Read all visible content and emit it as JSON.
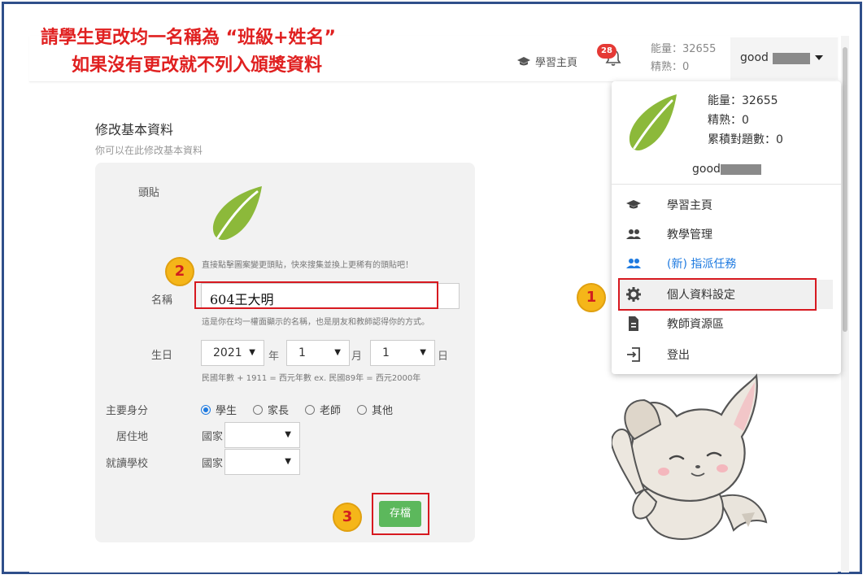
{
  "annotation": {
    "line1": "請學生更改均一名稱為 “班級+姓名”",
    "line2": "如果沒有更改就不列入頒獎資料",
    "steps": [
      "1",
      "2",
      "3"
    ]
  },
  "header": {
    "home_link": "學習主頁",
    "notifications": "28",
    "energy": "能量：32655",
    "badges": "精熟：0",
    "username": "good"
  },
  "main": {
    "title": "修改基本資料",
    "subtitle": "你可以在此修改基本資料",
    "avatar_label": "頭貼",
    "avatar_hint": "直接點擊圖案變更頭貼，快來搜集並換上更稀有的頭貼吧！",
    "name_label": "名稱",
    "name_value": "604王大明",
    "name_hint": "這是你在均一權面顯示的名稱，也是朋友和教師認得你的方式。",
    "birthday_label": "生日",
    "year_value": "2021",
    "year_unit": "年",
    "month_value": "1",
    "month_unit": "月",
    "day_value": "1",
    "day_unit": "日",
    "birthday_hint": "民國年數 + 1911 = 西元年數 ex. 民國89年 = 西元2000年",
    "identity_label": "主要身分",
    "identity_options": [
      "學生",
      "家長",
      "老師",
      "其他"
    ],
    "identity_selected": "學生",
    "residence_label": "居住地",
    "school_label": "就讀學校",
    "country_prefix": "國家",
    "save_label": "存檔"
  },
  "dropdown": {
    "energy": "能量：32655",
    "badges": "精熟：0",
    "answered": "累積對題數：0",
    "username": "good",
    "items": [
      {
        "label": "學習主頁",
        "icon": "graduation-cap-icon",
        "color": "#333333"
      },
      {
        "label": "教學管理",
        "icon": "users-icon",
        "color": "#333333"
      },
      {
        "label": "(新) 指派任務",
        "icon": "users-icon",
        "color": "#1e7ae0"
      },
      {
        "label": "個人資料設定",
        "icon": "gear-icon",
        "color": "#333333"
      },
      {
        "label": "教師資源區",
        "icon": "document-icon",
        "color": "#333333"
      },
      {
        "label": "登出",
        "icon": "logout-icon",
        "color": "#333333"
      }
    ]
  },
  "colors": {
    "accent_red": "#d71920",
    "save_green": "#5cb85c",
    "step_circle": "#f5b619",
    "badge_red": "#e53935",
    "link_blue": "#1e7ae0"
  }
}
